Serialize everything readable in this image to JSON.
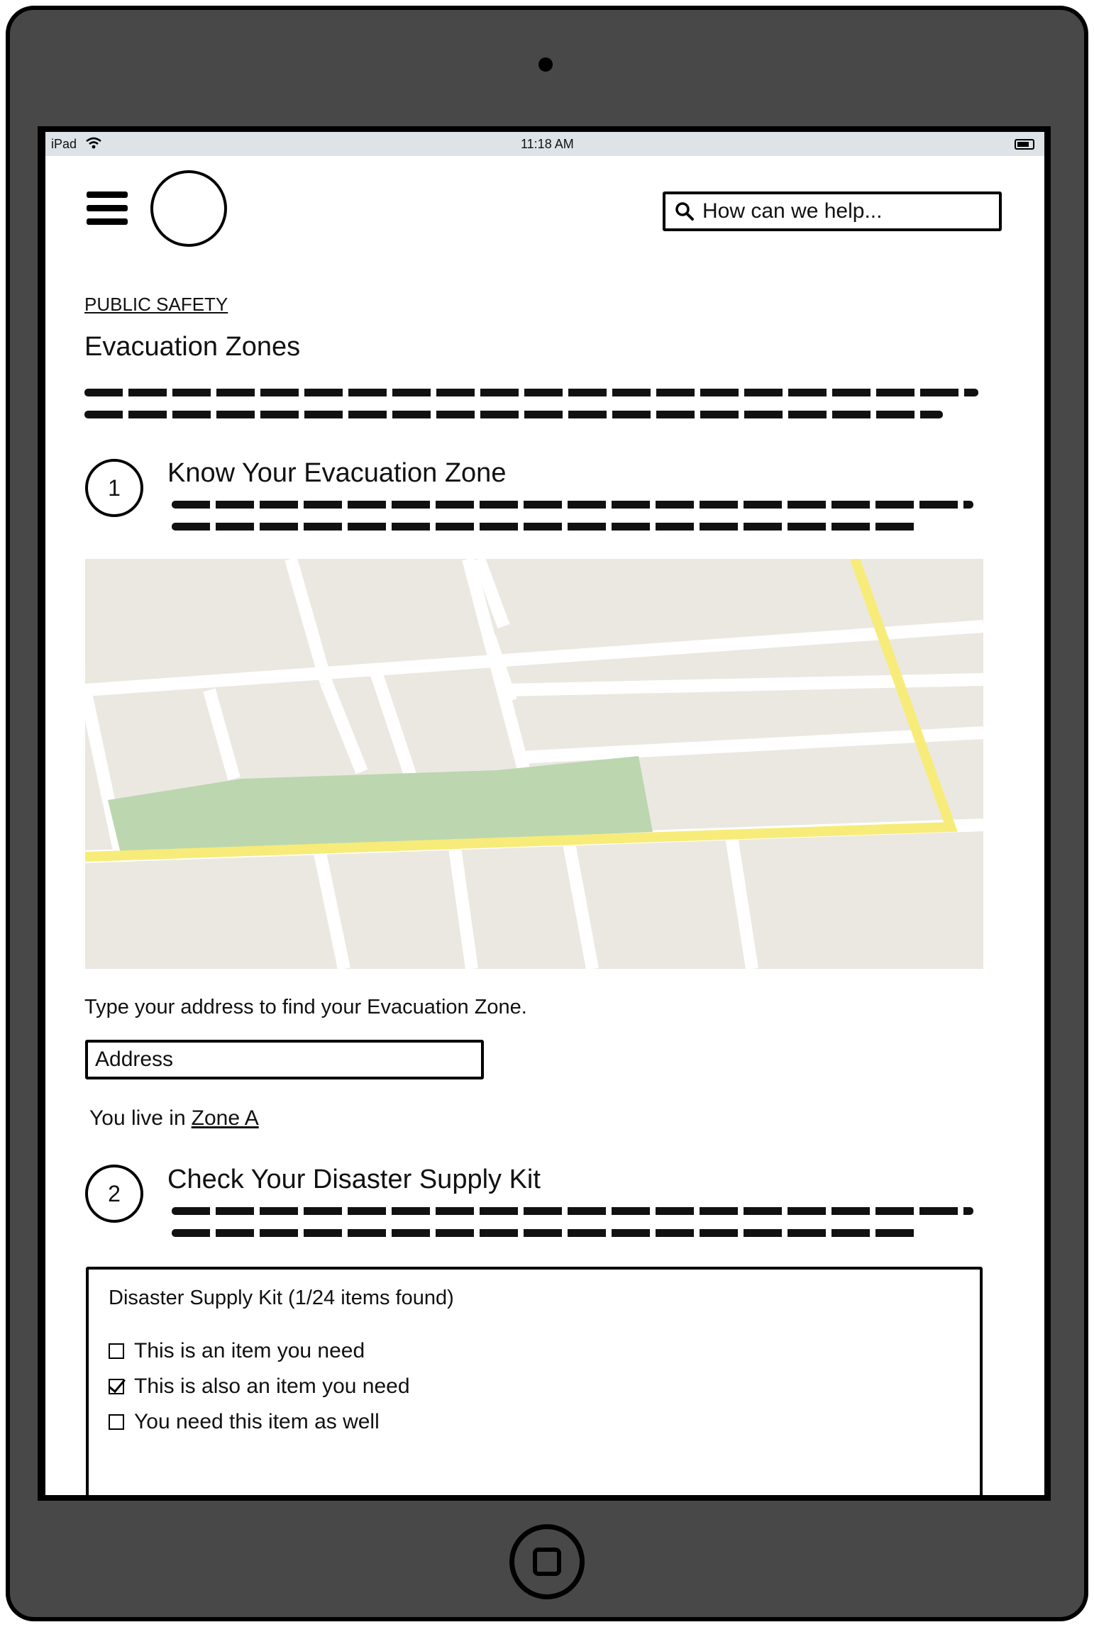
{
  "status_bar": {
    "device": "iPad",
    "time": "11:18 AM",
    "icons": [
      "wifi-icon",
      "battery-icon"
    ]
  },
  "header": {
    "menu_icon": "hamburger-menu-icon",
    "logo_icon": "circle-logo",
    "search": {
      "placeholder": "How can we help...",
      "icon": "search-icon"
    }
  },
  "breadcrumb": "PUBLIC SAFETY",
  "page_title": "Evacuation Zones",
  "steps": [
    {
      "number": "1",
      "title": "Know Your Evacuation Zone"
    },
    {
      "number": "2",
      "title": "Check Your Disaster Supply Kit"
    }
  ],
  "map": {
    "colors": {
      "land": "#ebe8e1",
      "road": "#ffffff",
      "highlight_route": "#f7ec79",
      "zone_area": "#bcd6af"
    }
  },
  "address_lookup": {
    "prompt": "Type your address to find your Evacuation Zone.",
    "placeholder": "Address",
    "result_prefix": "You live in",
    "result_zone": "Zone A"
  },
  "supply_kit": {
    "heading": "Disaster Supply Kit (1/24 items found)",
    "items": [
      {
        "label": "This is an item you need",
        "checked": false
      },
      {
        "label": "This is also an item you need",
        "checked": true
      },
      {
        "label": "You need this item as well",
        "checked": false
      }
    ]
  }
}
